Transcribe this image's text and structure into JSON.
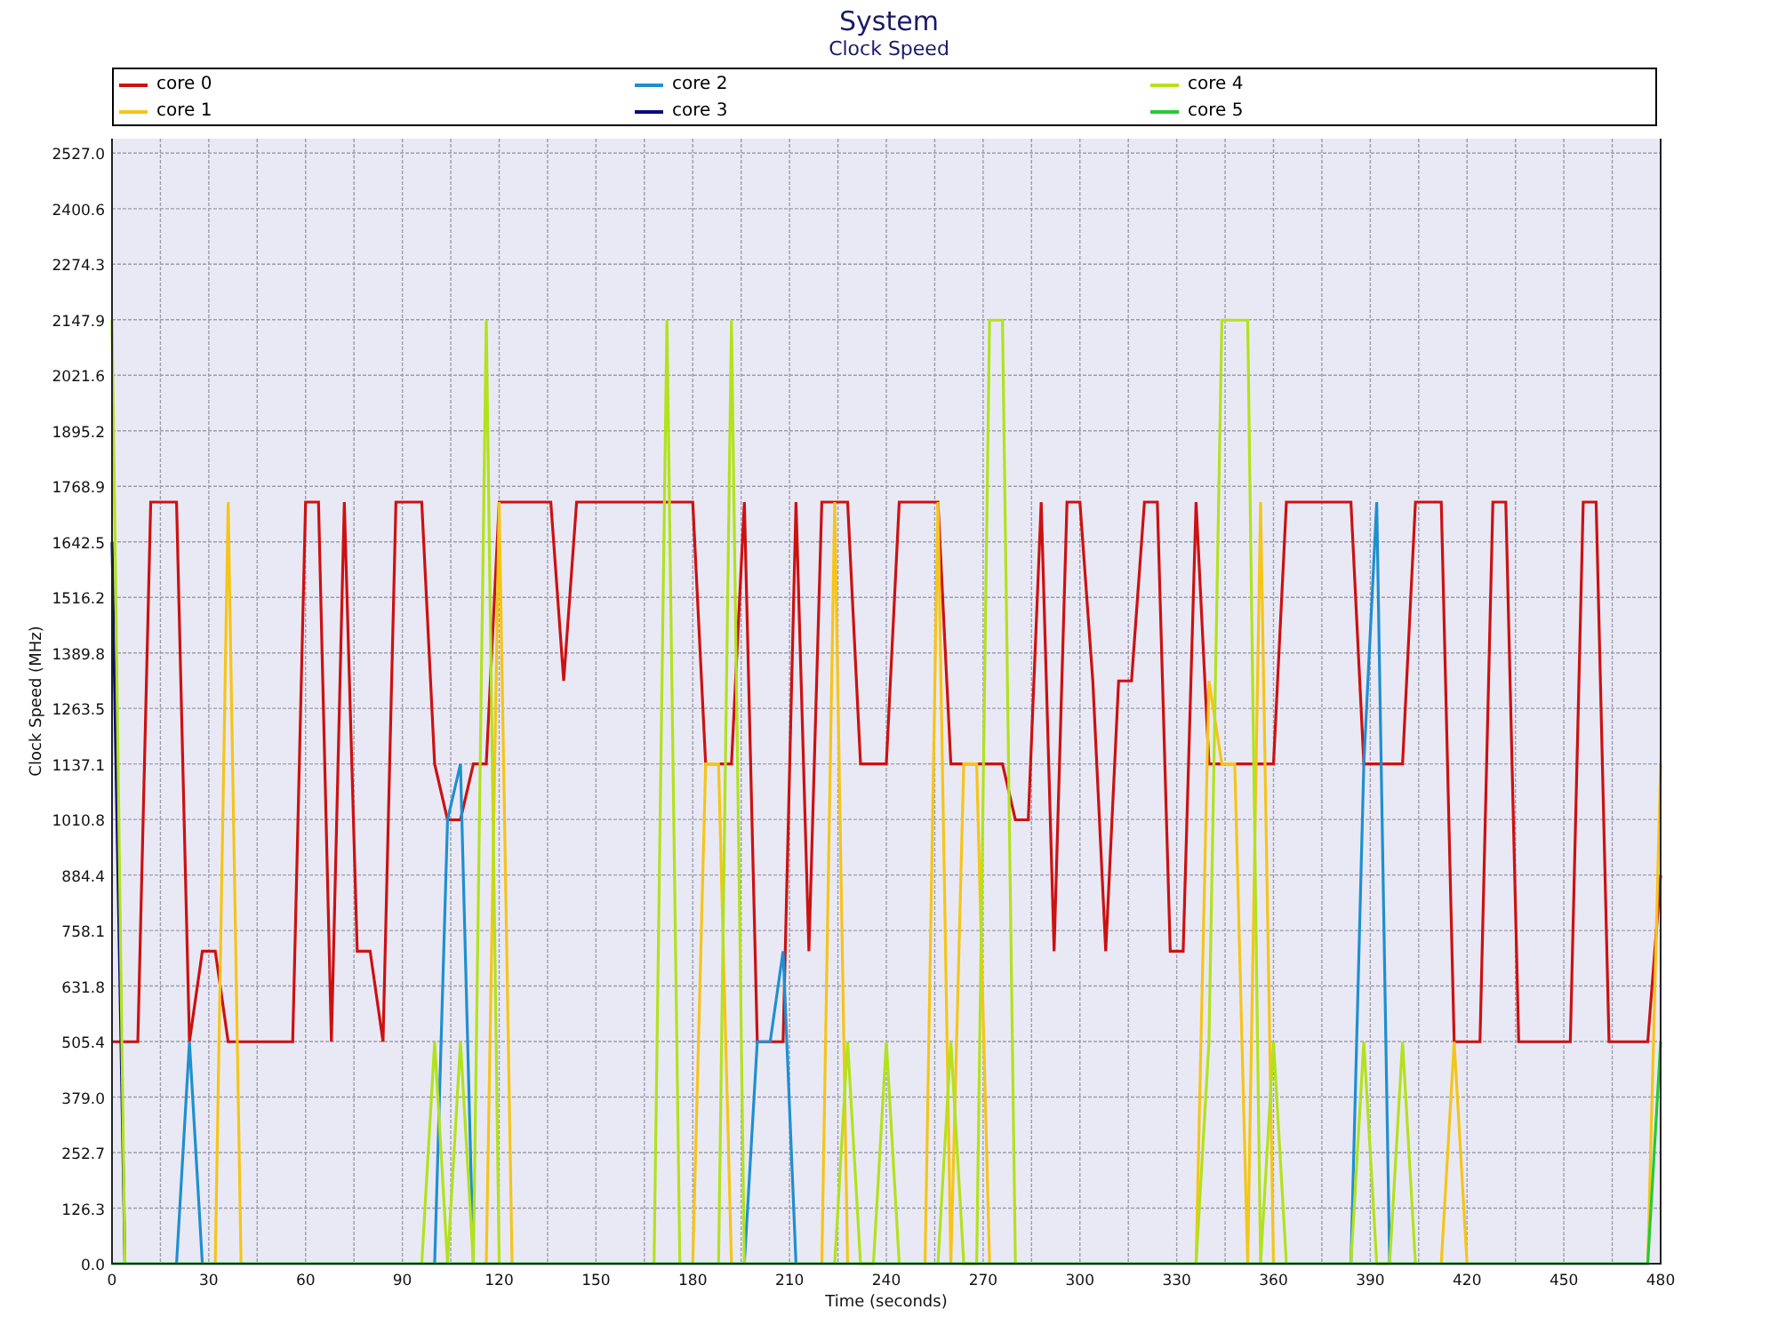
{
  "header": {
    "title": "System",
    "subtitle": "Clock Speed"
  },
  "chart": {
    "chart_data": {
      "type": "line",
      "grid": true,
      "xlabel": "Time (seconds)",
      "ylabel": "Clock Speed (MHz)",
      "xlim": [
        0,
        480
      ],
      "ylim": [
        0,
        2560
      ],
      "xticks": [
        0,
        30,
        60,
        90,
        120,
        150,
        180,
        210,
        240,
        270,
        300,
        330,
        360,
        390,
        420,
        450,
        480
      ],
      "yticks": [
        {
          "value": 0,
          "label": "0.0"
        },
        {
          "value": 126.3,
          "label": "126.3"
        },
        {
          "value": 252.7,
          "label": "252.7"
        },
        {
          "value": 379.0,
          "label": "379.0"
        },
        {
          "value": 505.4,
          "label": "505.4"
        },
        {
          "value": 631.8,
          "label": "631.8"
        },
        {
          "value": 758.1,
          "label": "758.1"
        },
        {
          "value": 884.4,
          "label": "884.4"
        },
        {
          "value": 1010.8,
          "label": "1010.8"
        },
        {
          "value": 1137.1,
          "label": "1137.1"
        },
        {
          "value": 1263.5,
          "label": "1263.5"
        },
        {
          "value": 1389.8,
          "label": "1389.8"
        },
        {
          "value": 1516.2,
          "label": "1516.2"
        },
        {
          "value": 1642.5,
          "label": "1642.5"
        },
        {
          "value": 1768.9,
          "label": "1768.9"
        },
        {
          "value": 1895.2,
          "label": "1895.2"
        },
        {
          "value": 2021.6,
          "label": "2021.6"
        },
        {
          "value": 2147.9,
          "label": "2147.9"
        },
        {
          "value": 2274.3,
          "label": "2274.3"
        },
        {
          "value": 2400.6,
          "label": "2400.6"
        },
        {
          "value": 2527.0,
          "label": "2527.0"
        }
      ],
      "x": [
        0,
        4,
        8,
        12,
        16,
        20,
        24,
        28,
        32,
        36,
        40,
        44,
        48,
        52,
        56,
        60,
        64,
        68,
        72,
        76,
        80,
        84,
        88,
        92,
        96,
        100,
        104,
        108,
        112,
        116,
        120,
        124,
        128,
        132,
        136,
        140,
        144,
        148,
        152,
        156,
        160,
        164,
        168,
        172,
        176,
        180,
        184,
        188,
        192,
        196,
        200,
        204,
        208,
        212,
        216,
        220,
        224,
        228,
        232,
        236,
        240,
        244,
        248,
        252,
        256,
        260,
        264,
        268,
        272,
        276,
        280,
        284,
        288,
        292,
        296,
        300,
        304,
        308,
        312,
        316,
        320,
        324,
        328,
        332,
        336,
        340,
        344,
        348,
        352,
        356,
        360,
        364,
        368,
        372,
        376,
        380,
        384,
        388,
        392,
        396,
        400,
        404,
        408,
        412,
        416,
        420,
        424,
        428,
        432,
        436,
        440,
        444,
        448,
        452,
        456,
        460,
        464,
        468,
        472,
        476,
        480
      ],
      "series": [
        {
          "name": "core 0",
          "color": "#cc1111",
          "values": [
            505,
            505,
            505,
            1733,
            1733,
            1733,
            505,
            711,
            711,
            505,
            505,
            505,
            505,
            505,
            505,
            1733,
            1733,
            505,
            1733,
            711,
            711,
            505,
            1733,
            1733,
            1733,
            1137,
            1010,
            1010,
            1137,
            1137,
            1733,
            1733,
            1733,
            1733,
            1733,
            1326,
            1733,
            1733,
            1733,
            1733,
            1733,
            1733,
            1733,
            1733,
            1733,
            1733,
            1137,
            1137,
            1137,
            1733,
            505,
            505,
            505,
            1733,
            711,
            1733,
            1733,
            1733,
            1137,
            1137,
            1137,
            1733,
            1733,
            1733,
            1733,
            1137,
            1137,
            1137,
            1137,
            1137,
            1010,
            1010,
            1733,
            711,
            1733,
            1733,
            1326,
            711,
            1326,
            1326,
            1733,
            1733,
            711,
            711,
            1733,
            1137,
            1137,
            1137,
            1137,
            1137,
            1137,
            1733,
            1733,
            1733,
            1733,
            1733,
            1733,
            1137,
            1137,
            1137,
            1137,
            1733,
            1733,
            1733,
            505,
            505,
            505,
            1733,
            1733,
            505,
            505,
            505,
            505,
            505,
            1733,
            1733,
            505,
            505,
            505,
            505,
            884
          ]
        },
        {
          "name": "core 1",
          "color": "#f5c518",
          "values": [
            null,
            null,
            null,
            null,
            null,
            null,
            null,
            null,
            0,
            1733,
            0,
            null,
            null,
            null,
            null,
            null,
            null,
            null,
            null,
            null,
            null,
            null,
            null,
            null,
            null,
            null,
            null,
            null,
            null,
            0,
            1733,
            0,
            null,
            null,
            null,
            null,
            null,
            null,
            null,
            null,
            null,
            null,
            null,
            null,
            null,
            0,
            1137,
            1137,
            0,
            null,
            null,
            null,
            null,
            null,
            null,
            0,
            1733,
            0,
            null,
            null,
            null,
            null,
            null,
            0,
            1733,
            0,
            1137,
            1137,
            0,
            null,
            null,
            null,
            null,
            null,
            null,
            null,
            null,
            null,
            null,
            null,
            null,
            null,
            null,
            null,
            0,
            1326,
            1137,
            1137,
            0,
            1733,
            0,
            null,
            null,
            null,
            null,
            null,
            null,
            null,
            null,
            null,
            null,
            null,
            null,
            0,
            505,
            0,
            null,
            null,
            null,
            null,
            null,
            null,
            null,
            null,
            null,
            null,
            null,
            null,
            null,
            0,
            1137
          ]
        },
        {
          "name": "core 2",
          "color": "#1f8fd0",
          "values": [
            null,
            null,
            null,
            null,
            null,
            0,
            505,
            0,
            null,
            null,
            null,
            null,
            null,
            null,
            null,
            null,
            null,
            null,
            null,
            null,
            null,
            null,
            null,
            null,
            null,
            0,
            1010,
            1137,
            0,
            null,
            null,
            null,
            null,
            null,
            null,
            null,
            null,
            null,
            null,
            null,
            null,
            null,
            null,
            null,
            null,
            null,
            null,
            null,
            null,
            0,
            505,
            505,
            711,
            0,
            null,
            null,
            null,
            null,
            null,
            null,
            null,
            null,
            null,
            null,
            null,
            null,
            null,
            null,
            null,
            null,
            null,
            null,
            null,
            null,
            null,
            null,
            null,
            null,
            null,
            null,
            null,
            null,
            null,
            null,
            null,
            null,
            null,
            null,
            null,
            null,
            null,
            null,
            null,
            null,
            null,
            null,
            0,
            1137,
            1733,
            0,
            null,
            null,
            null,
            null,
            null,
            null,
            null,
            null,
            null,
            null,
            null,
            null,
            null,
            null,
            null,
            null,
            null,
            null,
            null,
            null,
            null
          ]
        },
        {
          "name": "core 3",
          "color": "#0a0a80",
          "values": [
            1642,
            0,
            null,
            null,
            null,
            null,
            null,
            null,
            null,
            null,
            null,
            null,
            null,
            null,
            null,
            null,
            null,
            null,
            null,
            null,
            null,
            null,
            null,
            null,
            null,
            null,
            null,
            null,
            null,
            null,
            null,
            null,
            null,
            null,
            null,
            null,
            null,
            null,
            null,
            null,
            null,
            null,
            null,
            null,
            null,
            null,
            null,
            null,
            null,
            null,
            null,
            null,
            null,
            null,
            null,
            null,
            null,
            null,
            null,
            null,
            null,
            null,
            null,
            null,
            null,
            null,
            null,
            null,
            null,
            null,
            null,
            null,
            null,
            null,
            null,
            null,
            null,
            null,
            null,
            null,
            null,
            null,
            null,
            null,
            null,
            null,
            null,
            null,
            null,
            null,
            null,
            null,
            null,
            null,
            null,
            null,
            null,
            null,
            null,
            null,
            null,
            null,
            null,
            null,
            null,
            null,
            null,
            null,
            null,
            null,
            null,
            null,
            null,
            null,
            null,
            null,
            null,
            null,
            null,
            null,
            null
          ]
        },
        {
          "name": "core 4",
          "color": "#b2e21c",
          "values": [
            2147,
            0,
            null,
            null,
            null,
            null,
            null,
            null,
            null,
            null,
            null,
            null,
            null,
            null,
            null,
            null,
            null,
            null,
            null,
            null,
            null,
            null,
            null,
            null,
            0,
            505,
            0,
            505,
            0,
            2147,
            0,
            null,
            null,
            null,
            null,
            null,
            null,
            null,
            null,
            null,
            null,
            null,
            0,
            2147,
            0,
            null,
            null,
            0,
            2147,
            0,
            null,
            null,
            null,
            null,
            null,
            null,
            0,
            505,
            0,
            0,
            505,
            0,
            null,
            null,
            0,
            505,
            0,
            0,
            2147,
            2147,
            0,
            null,
            null,
            null,
            null,
            null,
            null,
            null,
            null,
            null,
            null,
            null,
            null,
            null,
            0,
            505,
            2147,
            2147,
            2147,
            0,
            505,
            0,
            null,
            null,
            null,
            null,
            0,
            505,
            0,
            0,
            505,
            0,
            null,
            null,
            null,
            null,
            null,
            null,
            null,
            null,
            null,
            null,
            null,
            null,
            null,
            null,
            null,
            null,
            null,
            null,
            null
          ]
        },
        {
          "name": "core 5",
          "color": "#22cc33",
          "values": [
            0,
            0,
            0,
            0,
            0,
            0,
            0,
            0,
            0,
            0,
            0,
            0,
            0,
            0,
            0,
            0,
            0,
            0,
            0,
            0,
            0,
            0,
            0,
            0,
            0,
            0,
            0,
            0,
            0,
            0,
            0,
            0,
            0,
            0,
            0,
            0,
            0,
            0,
            0,
            0,
            0,
            0,
            0,
            0,
            0,
            0,
            0,
            0,
            0,
            0,
            0,
            0,
            0,
            0,
            0,
            0,
            0,
            0,
            0,
            0,
            0,
            0,
            0,
            0,
            0,
            0,
            0,
            0,
            0,
            0,
            0,
            0,
            0,
            0,
            0,
            0,
            0,
            0,
            0,
            0,
            0,
            0,
            0,
            0,
            0,
            0,
            0,
            0,
            0,
            0,
            0,
            0,
            0,
            0,
            0,
            0,
            0,
            0,
            0,
            0,
            0,
            0,
            0,
            0,
            0,
            0,
            0,
            0,
            0,
            0,
            0,
            0,
            0,
            0,
            0,
            0,
            0,
            0,
            0,
            0,
            505
          ]
        }
      ]
    }
  }
}
